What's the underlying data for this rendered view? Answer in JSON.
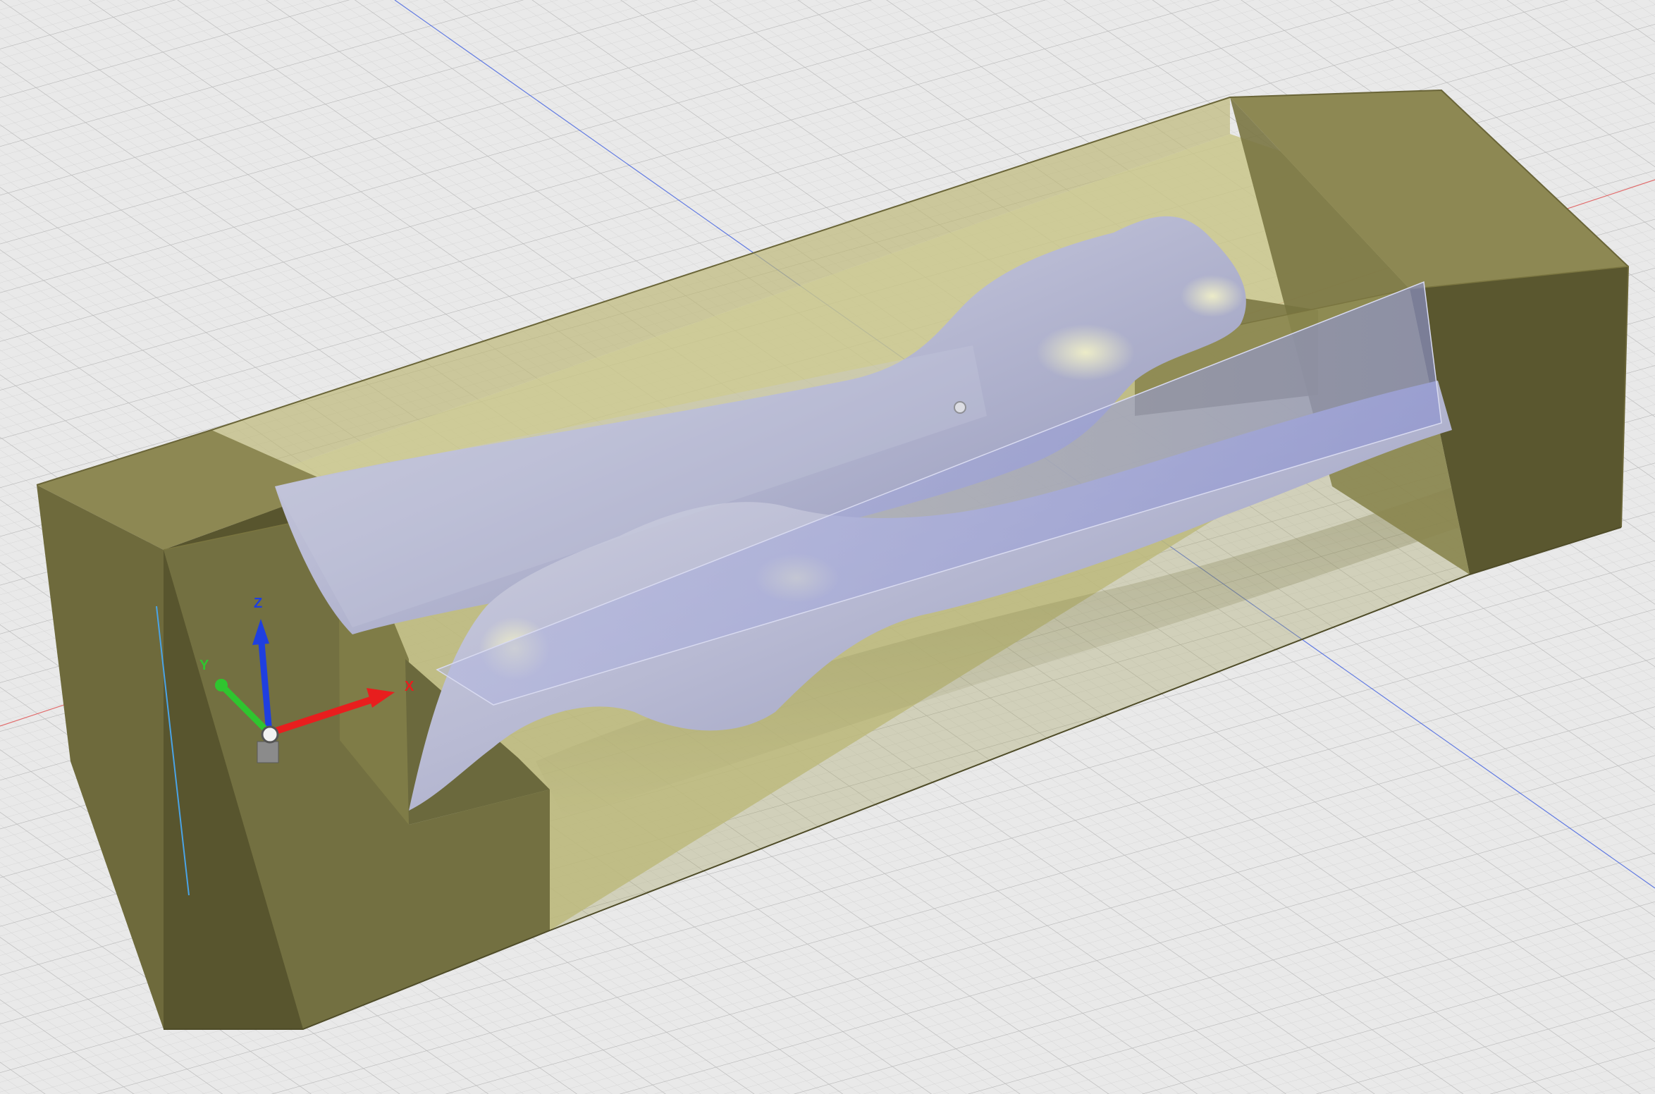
{
  "viewport": {
    "background": "#e9e9e9",
    "grid_minor_color": "#d2d2d2",
    "grid_major_color": "#b4b4b4",
    "world_x_axis_color": "#e05050",
    "world_y_axis_color": "#3f5fe0",
    "world_z_axis_color": "#4aa3e6"
  },
  "mold_block": {
    "color": "#8a8550",
    "interior_color": "#c9c58a",
    "opacity": 0.75
  },
  "scanned_body": {
    "color": "#b9bbd2",
    "highlight": "#e6e7c8"
  },
  "parting_surface": {
    "color": "#9aa0d2",
    "opacity": 0.55
  },
  "triad": {
    "x_label": "X",
    "y_label": "Y",
    "z_label": "Z",
    "x_color": "#e81e1e",
    "y_color": "#2fc52f",
    "z_color": "#1f3fe0"
  }
}
